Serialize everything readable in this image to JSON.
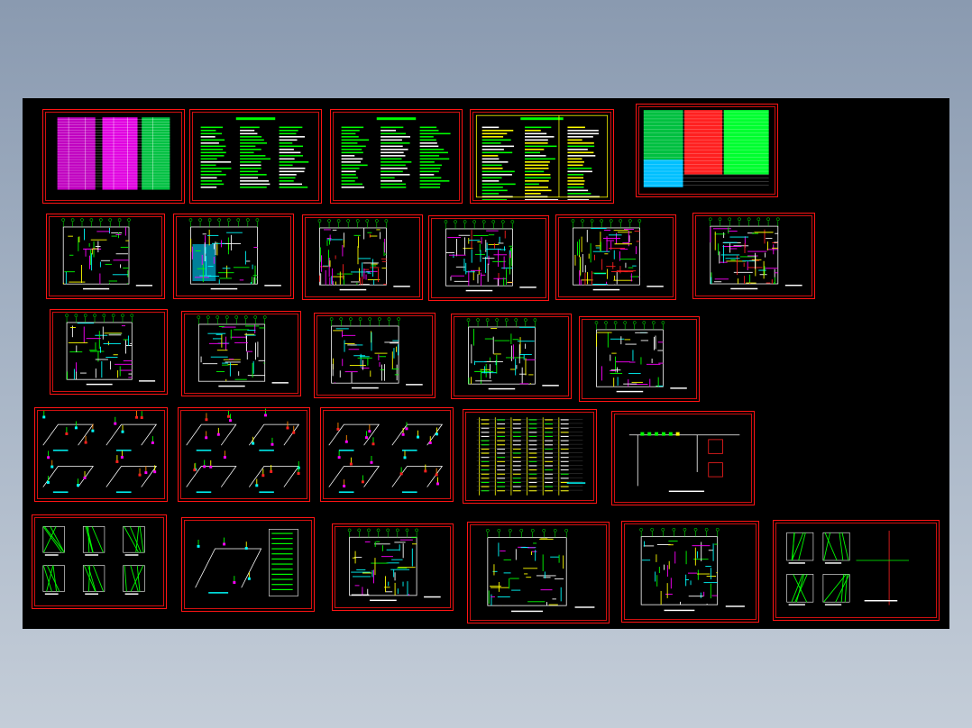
{
  "viewport": {
    "background_color": "#000000",
    "frame_color": "#ff1414"
  },
  "sheets": [
    {
      "kind": "table-magenta"
    },
    {
      "kind": "notes-green"
    },
    {
      "kind": "notes-green"
    },
    {
      "kind": "table-yellow"
    },
    {
      "kind": "table-red-green"
    },
    {
      "kind": "plan-small"
    },
    {
      "kind": "plan-cyan"
    },
    {
      "kind": "plan-dense"
    },
    {
      "kind": "plan-dense"
    },
    {
      "kind": "plan-dense"
    },
    {
      "kind": "plan-dense"
    },
    {
      "kind": "plan-section"
    },
    {
      "kind": "plan-wide"
    },
    {
      "kind": "plan-wide"
    },
    {
      "kind": "plan-wide"
    },
    {
      "kind": "elevation"
    },
    {
      "kind": "iso-pipes"
    },
    {
      "kind": "iso-pipes"
    },
    {
      "kind": "iso-pipes"
    },
    {
      "kind": "riser"
    },
    {
      "kind": "schematic"
    },
    {
      "kind": "details"
    },
    {
      "kind": "iso-single"
    },
    {
      "kind": "plan-detail"
    },
    {
      "kind": "plan-room"
    },
    {
      "kind": "plan-long"
    },
    {
      "kind": "details-green"
    }
  ]
}
